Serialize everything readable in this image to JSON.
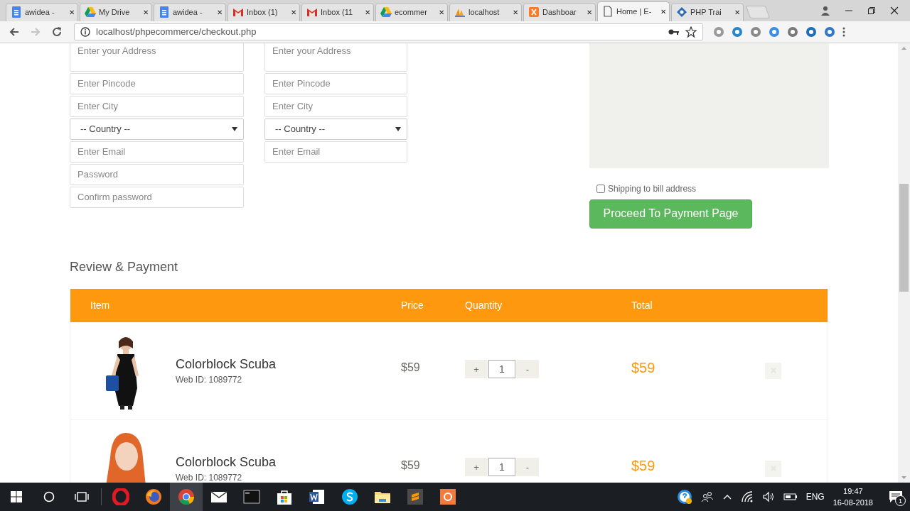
{
  "browser": {
    "tabs": [
      {
        "label": "awidea -",
        "kind": "docs",
        "selected": false
      },
      {
        "label": "My Drive",
        "kind": "drive",
        "selected": false
      },
      {
        "label": "awidea -",
        "kind": "docs",
        "selected": false
      },
      {
        "label": "Inbox (1)",
        "kind": "gmail",
        "selected": false
      },
      {
        "label": "Inbox (11",
        "kind": "gmail",
        "selected": false
      },
      {
        "label": "ecommer",
        "kind": "drive",
        "selected": false
      },
      {
        "label": "localhost",
        "kind": "pma",
        "selected": false
      },
      {
        "label": "Dashboar",
        "kind": "xampp",
        "selected": false
      },
      {
        "label": "Home | E-",
        "kind": "page",
        "selected": true
      },
      {
        "label": "PHP Trai",
        "kind": "php",
        "selected": false
      }
    ],
    "close_glyph": "✕",
    "url": "localhost/phpecommerce/checkout.php"
  },
  "bill_form": {
    "fields": [
      {
        "kind": "textarea",
        "placeholder": "Enter your Address"
      },
      {
        "kind": "input",
        "placeholder": "Enter Pincode"
      },
      {
        "kind": "input",
        "placeholder": "Enter City"
      },
      {
        "kind": "select",
        "value": "-- Country --"
      },
      {
        "kind": "input",
        "placeholder": "Enter Email"
      },
      {
        "kind": "password",
        "placeholder": "Password"
      },
      {
        "kind": "password",
        "placeholder": "Confirm password"
      }
    ]
  },
  "ship_form": {
    "fields": [
      {
        "kind": "textarea",
        "placeholder": "Enter your Address"
      },
      {
        "kind": "input",
        "placeholder": "Enter Pincode"
      },
      {
        "kind": "input",
        "placeholder": "Enter City"
      },
      {
        "kind": "select",
        "value": "-- Country --"
      },
      {
        "kind": "input",
        "placeholder": "Enter Email"
      }
    ]
  },
  "shipping_option": {
    "label": "Shipping to bill address",
    "checked": false
  },
  "proceed_button": "Proceed To Payment Page",
  "review": {
    "title": "Review & Payment",
    "columns": [
      "Item",
      "Price",
      "Quantity",
      "Total"
    ],
    "rows": [
      {
        "name": "Colorblock Scuba",
        "web_id": "Web ID: 1089772",
        "price": "$59",
        "plus": "+",
        "quantity": "1",
        "minus": "-",
        "total": "$59"
      },
      {
        "name": "Colorblock Scuba",
        "web_id": "Web ID: 1089772",
        "price": "$59",
        "plus": "+",
        "quantity": "1",
        "minus": "-",
        "total": "$59"
      }
    ]
  },
  "taskbar": {
    "apps": [
      {
        "kind": "opera",
        "active": false
      },
      {
        "kind": "firefox",
        "active": false
      },
      {
        "kind": "chrome",
        "active": true
      },
      {
        "kind": "mail",
        "active": false
      },
      {
        "kind": "cmd",
        "active": false
      },
      {
        "kind": "store",
        "active": false
      },
      {
        "kind": "word",
        "active": false
      },
      {
        "kind": "skype",
        "active": false
      },
      {
        "kind": "folder",
        "active": false
      },
      {
        "kind": "sublime",
        "active": false
      },
      {
        "kind": "recorder",
        "active": false
      }
    ],
    "language": "ENG",
    "time": "19:47",
    "date": "16-08-2018",
    "notifications": "1"
  }
}
